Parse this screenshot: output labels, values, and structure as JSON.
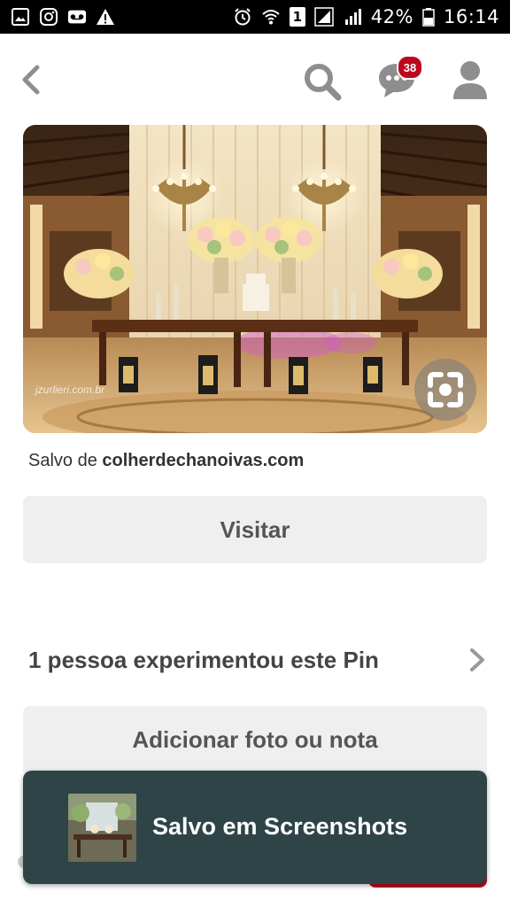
{
  "status_bar": {
    "battery_percent": "42%",
    "time": "16:14",
    "sim_label": "1"
  },
  "header": {
    "notification_count": "38"
  },
  "pin": {
    "watermark": "jzurlieri.com.br",
    "saved_from_prefix": "Salvo de",
    "saved_from_domain": "colherdechanoivas.com",
    "visit_label": "Visitar",
    "tried_label": "1 pessoa experimentou este Pin",
    "add_label": "Adicionar foto ou nota"
  },
  "toast": {
    "message": "Salvo em Screenshots"
  },
  "colors": {
    "pinterest_red": "#bd081c",
    "toast_bg": "#2f4447",
    "button_bg": "#efefef"
  }
}
